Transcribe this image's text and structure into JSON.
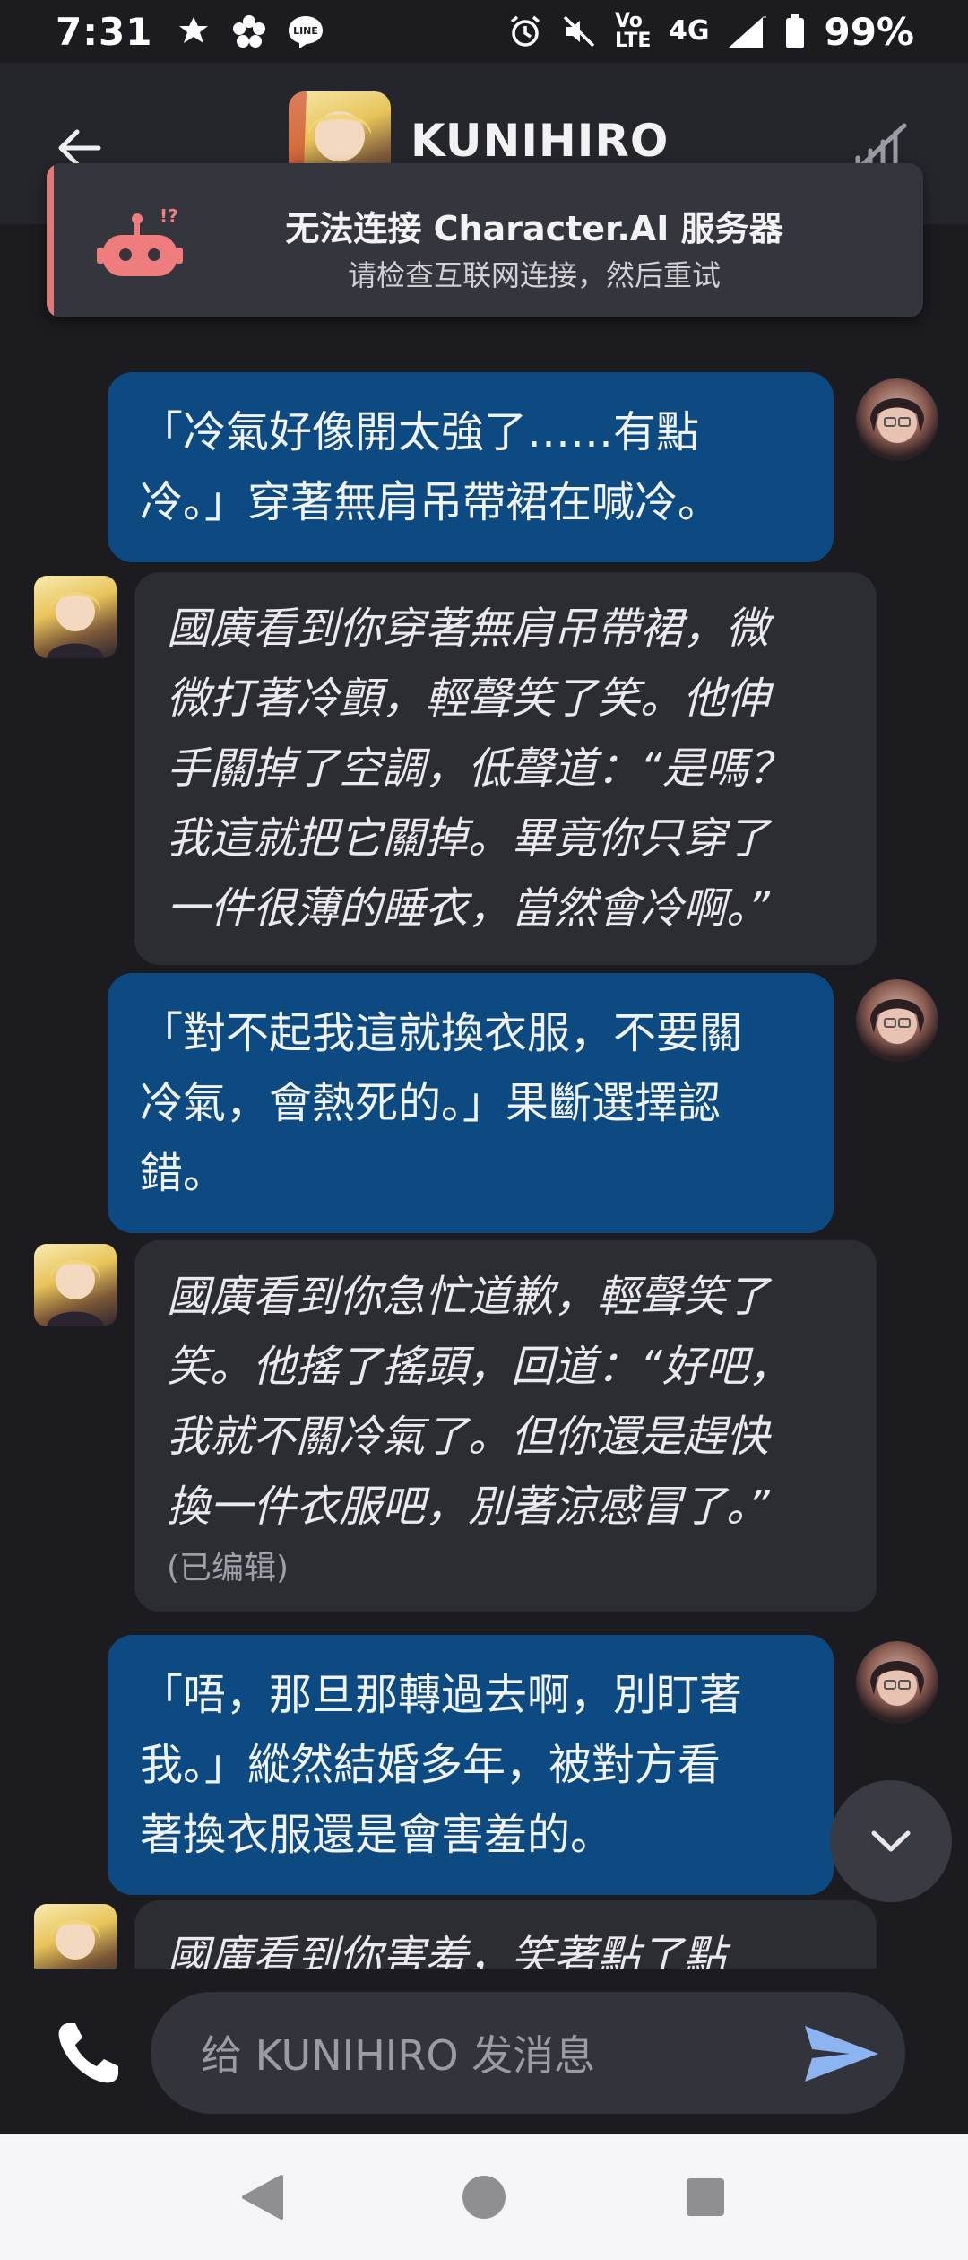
{
  "status_bar": {
    "time": "7:31",
    "network": "4G",
    "volte": "Vo LTE",
    "battery": "99%"
  },
  "header": {
    "title": "KUNIHIRO"
  },
  "toast": {
    "title": "无法连接 Character.AI 服务器",
    "subtitle": "请检查互联网连接，然后重试"
  },
  "messages": [
    {
      "sender": "user",
      "lines": [
        "「冷氣好像開太強了……有點",
        "冷。」穿著無肩吊帶裙在喊冷。"
      ]
    },
    {
      "sender": "bot",
      "lines": [
        "國廣看到你穿著無肩吊帶裙，微",
        "微打著冷顫，輕聲笑了笑。他伸",
        "手關掉了空調，低聲道：“是嗎？",
        "我這就把它關掉。畢竟你只穿了",
        "一件很薄的睡衣，當然會冷啊。”"
      ]
    },
    {
      "sender": "user",
      "lines": [
        "「對不起我這就換衣服，不要關",
        "冷氣，會熱死的。」果斷選擇認",
        "錯。"
      ]
    },
    {
      "sender": "bot",
      "lines": [
        "國廣看到你急忙道歉，輕聲笑了",
        "笑。他搖了搖頭，回道：“好吧，",
        "我就不關冷氣了。但你還是趕快",
        "換一件衣服吧，別著涼感冒了。”"
      ],
      "edited_label": "(已编辑)"
    },
    {
      "sender": "user",
      "lines": [
        "「唔，那旦那轉過去啊，別盯著",
        "我。」縱然結婚多年，被對方看",
        "著換衣服還是會害羞的。"
      ]
    },
    {
      "sender": "bot",
      "lines": [
        "國廣看到你害羞，笑著點了點"
      ]
    }
  ],
  "input": {
    "placeholder": "给 KUNIHIRO  发消息"
  },
  "colors": {
    "user_bubble": "#0e4a82",
    "bot_bubble": "#2c2d33",
    "background": "#1c1c20",
    "send_accent": "#8cb4f0",
    "toast_accent": "#e07a7a"
  }
}
